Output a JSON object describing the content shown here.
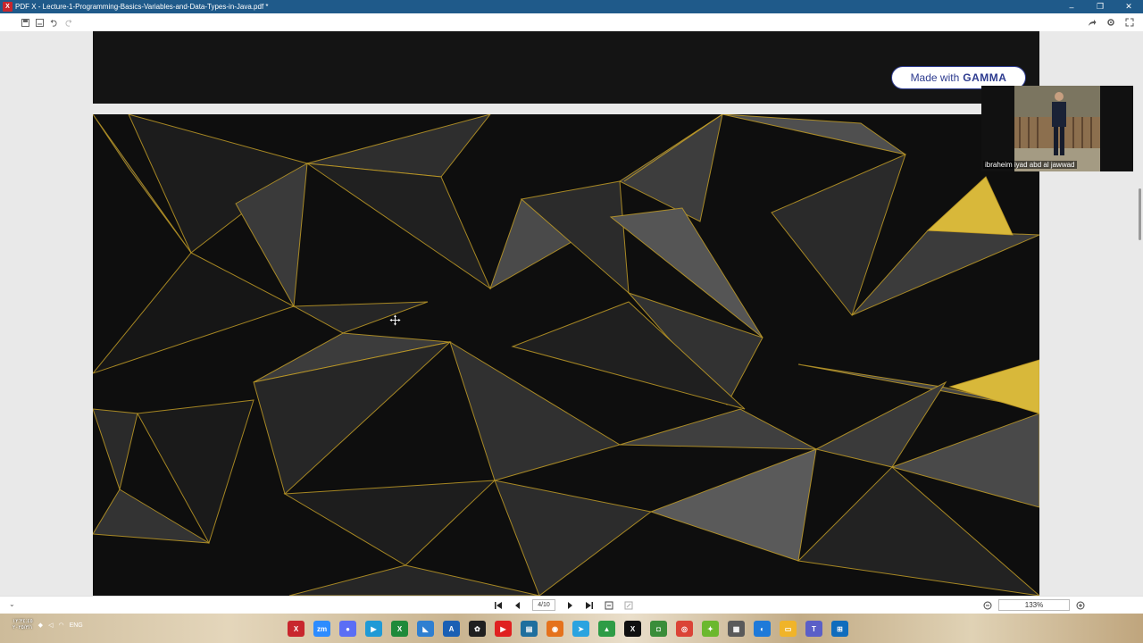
{
  "window": {
    "title": "PDF X - Lecture-1-Programming-Basics-Variables-and-Data-Types-in-Java.pdf *",
    "app_icon": "pdf-x-logo",
    "minimize_glyph": "–",
    "maximize_glyph": "❐",
    "close_glyph": "✕"
  },
  "toolbar": {
    "icons": [
      "save-icon",
      "save-as-icon",
      "undo-icon",
      "redo-icon"
    ],
    "right_icons": [
      "share-icon",
      "settings-icon",
      "fullscreen-icon"
    ]
  },
  "document": {
    "badge_prefix": "Made with",
    "badge_brand": "GAMMA",
    "background_colors": {
      "dark": "#0e0e0e",
      "facet": "#3a3a3a",
      "gold": "#d8b83a"
    }
  },
  "video": {
    "participant_name": "ibraheim iyad abd al jawwad"
  },
  "navbar": {
    "page_indicator": "4/10",
    "zoom_level": "133%"
  },
  "taskbar": {
    "clock_time": "١٢:٣٤:٤٥",
    "clock_date": "٢٠٢٥/٣/١",
    "language": "ENG"
  }
}
